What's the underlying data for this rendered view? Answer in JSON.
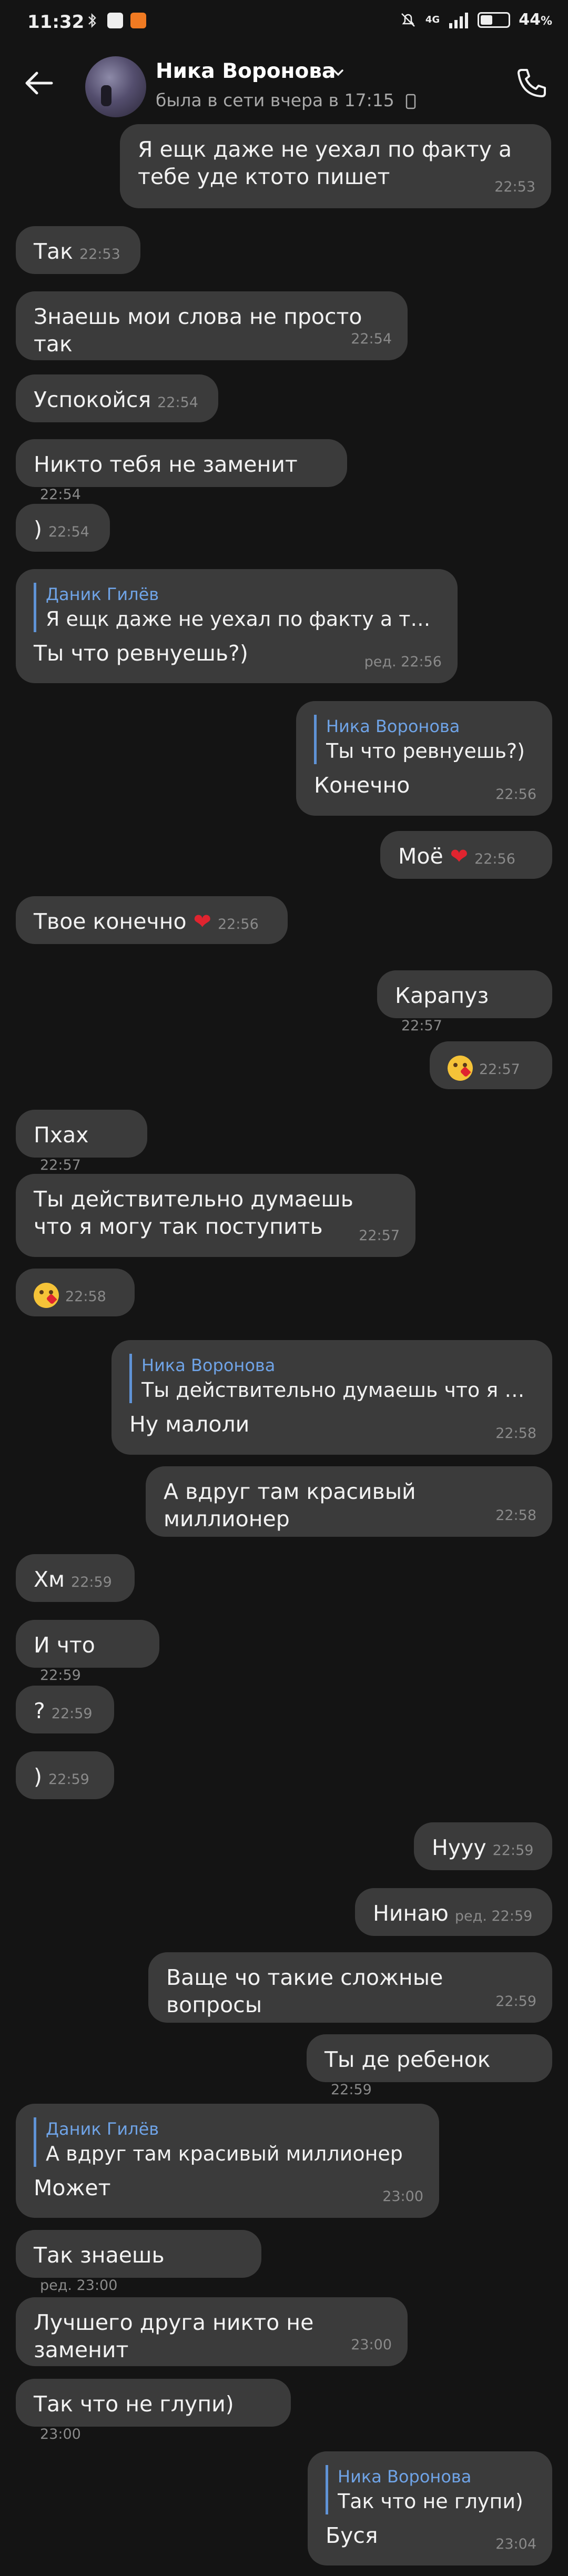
{
  "status_bar": {
    "time": "11:32",
    "network": "4G",
    "battery": "44",
    "battery_unit": "%",
    "battery_level": 0.44
  },
  "header": {
    "name": "Ника Воронова",
    "status": "была в сети вчера в 17:15"
  },
  "messages": [
    {
      "side": "out",
      "text": "Я ещк даже не уехал по факту а тебе уде ктото пишет",
      "time": "22:53"
    },
    {
      "side": "in",
      "text": "Так",
      "time": "22:53"
    },
    {
      "side": "in",
      "text": "Знаешь мои слова не просто так",
      "time": "22:54"
    },
    {
      "side": "in",
      "text": "Успокойся",
      "time": "22:54"
    },
    {
      "side": "in",
      "text": "Никто тебя не заменит",
      "time": "22:54"
    },
    {
      "side": "in",
      "text": ")",
      "time": "22:54"
    },
    {
      "side": "in",
      "reply_name": "Даник Гилёв",
      "reply_text": "Я ещк даже не уехал по факту а тебе…",
      "text": "Ты что ревнуешь?)",
      "edited": "ред.",
      "time": "22:56"
    },
    {
      "side": "out",
      "reply_name": "Ника Воронова",
      "reply_text": "Ты что ревнуешь?)",
      "text": "Конечно",
      "time": "22:56"
    },
    {
      "side": "out",
      "text": "Моё",
      "emoji": "heart",
      "time": "22:56"
    },
    {
      "side": "in",
      "text": "Твое конечно",
      "emoji": "heart",
      "time": "22:56"
    },
    {
      "side": "out",
      "text": "Карапуз",
      "time": "22:57"
    },
    {
      "side": "out",
      "text": "",
      "emoji": "kiss-face",
      "time": "22:57"
    },
    {
      "side": "in",
      "text": "Пхах",
      "time": "22:57"
    },
    {
      "side": "in",
      "text": "Ты действительно думаешь что я могу так поступить",
      "time": "22:57"
    },
    {
      "side": "in",
      "text": "",
      "emoji": "kiss-face",
      "time": "22:58"
    },
    {
      "side": "out",
      "reply_name": "Ника Воронова",
      "reply_text": "Ты действительно думаешь что я мо…",
      "text": "Ну малоли",
      "time": "22:58"
    },
    {
      "side": "out",
      "text": "А вдруг там красивый миллионер",
      "time": "22:58"
    },
    {
      "side": "in",
      "text": "Хм",
      "time": "22:59"
    },
    {
      "side": "in",
      "text": "И что",
      "time": "22:59"
    },
    {
      "side": "in",
      "text": "?",
      "time": "22:59"
    },
    {
      "side": "in",
      "text": ")",
      "time": "22:59"
    },
    {
      "side": "out",
      "text": "Нууу",
      "time": "22:59"
    },
    {
      "side": "out",
      "text": "Нинаю",
      "edited": "ред.",
      "time": "22:59"
    },
    {
      "side": "out",
      "text": "Ваще чо такие сложные вопросы",
      "time": "22:59"
    },
    {
      "side": "out",
      "text": "Ты де ребенок",
      "time": "22:59"
    },
    {
      "side": "in",
      "reply_name": "Даник Гилёв",
      "reply_text": "А вдруг там красивый миллионер",
      "text": "Может",
      "time": "23:00"
    },
    {
      "side": "in",
      "text": "Так знаешь",
      "edited": "ред.",
      "time": "23:00"
    },
    {
      "side": "in",
      "text": "Лучшего друга никто не заменит",
      "time": "23:00"
    },
    {
      "side": "in",
      "text": "Так  что не глупи)",
      "time": "23:00"
    },
    {
      "side": "out",
      "reply_name": "Ника Воронова",
      "reply_text": "Так  что не глупи)",
      "text": "Буся",
      "time": "23:04"
    }
  ],
  "colors": {
    "background": "#141414",
    "bubble": "#3b3b3b",
    "reply_accent": "#5f93d6",
    "heart": "#e0242f"
  }
}
